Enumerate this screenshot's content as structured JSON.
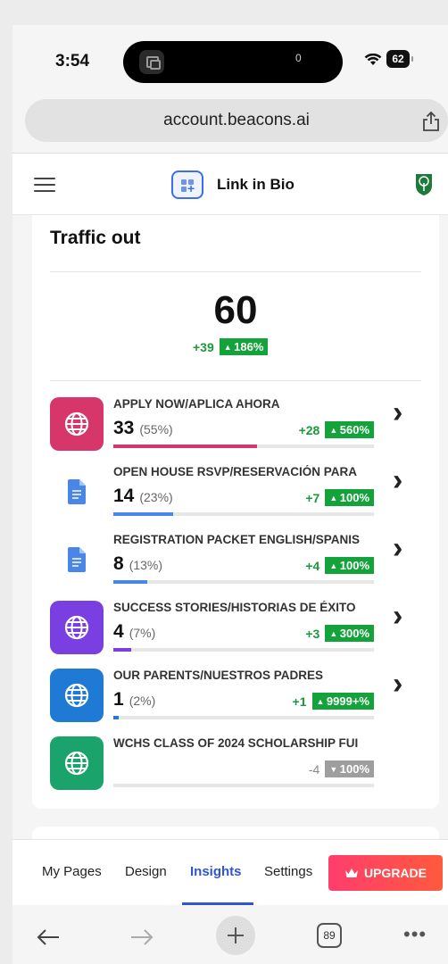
{
  "status_bar": {
    "time": "3:54",
    "island_indicator": "0",
    "battery": "62"
  },
  "browser": {
    "url": "account.beacons.ai",
    "tab_count": "89"
  },
  "app_header": {
    "title": "Link in Bio"
  },
  "traffic": {
    "title": "Traffic out",
    "total": "60",
    "total_change": "+39",
    "total_change_pct": "186%",
    "links": [
      {
        "name": "APPLY NOW/APLICA AHORA",
        "count": "33",
        "pct": "(55%)",
        "change": "+28",
        "change_pct": "560%",
        "icon": "globe-icon",
        "icon_color": "#d6366a",
        "bar_color": "#d6366a",
        "share": 0.55,
        "trend": "up"
      },
      {
        "name": "OPEN HOUSE RSVP/RESERVACIÓN PARA",
        "count": "14",
        "pct": "(23%)",
        "change": "+7",
        "change_pct": "100%",
        "icon": "google-doc-icon",
        "icon_color": "#ffffff",
        "bar_color": "#4a86e8",
        "share": 0.23,
        "trend": "up"
      },
      {
        "name": "REGISTRATION PACKET ENGLISH/SPANIS",
        "count": "8",
        "pct": "(13%)",
        "change": "+4",
        "change_pct": "100%",
        "icon": "google-doc-icon",
        "icon_color": "#ffffff",
        "bar_color": "#4a86e8",
        "share": 0.13,
        "trend": "up"
      },
      {
        "name": "SUCCESS STORIES/HISTORIAS DE ÉXITO",
        "count": "4",
        "pct": "(7%)",
        "change": "+3",
        "change_pct": "300%",
        "icon": "globe-icon",
        "icon_color": "#7a3fe0",
        "bar_color": "#7a3fe0",
        "share": 0.07,
        "trend": "up"
      },
      {
        "name": "OUR PARENTS/NUESTROS PADRES",
        "count": "1",
        "pct": "(2%)",
        "change": "+1",
        "change_pct": "9999+%",
        "icon": "globe-icon",
        "icon_color": "#1f7ad6",
        "bar_color": "#1f7ad6",
        "share": 0.02,
        "trend": "up"
      },
      {
        "name": "WCHS CLASS OF 2024 SCHOLARSHIP FUI",
        "count": "",
        "pct": "",
        "change": "-4",
        "change_pct": "100%",
        "icon": "globe-icon",
        "icon_color": "#1aa36b",
        "bar_color": "#1aa36b",
        "share": 0.0,
        "trend": "down"
      }
    ]
  },
  "tab_bar": {
    "tabs": [
      "My Pages",
      "Design",
      "Insights",
      "Settings"
    ],
    "active": "Insights",
    "upgrade_label": "UPGRADE"
  },
  "colors": {
    "accent": "#2f55d4",
    "positive": "#14a23b",
    "upgrade_start": "#ff3d6e",
    "upgrade_end": "#ff5a3c"
  }
}
